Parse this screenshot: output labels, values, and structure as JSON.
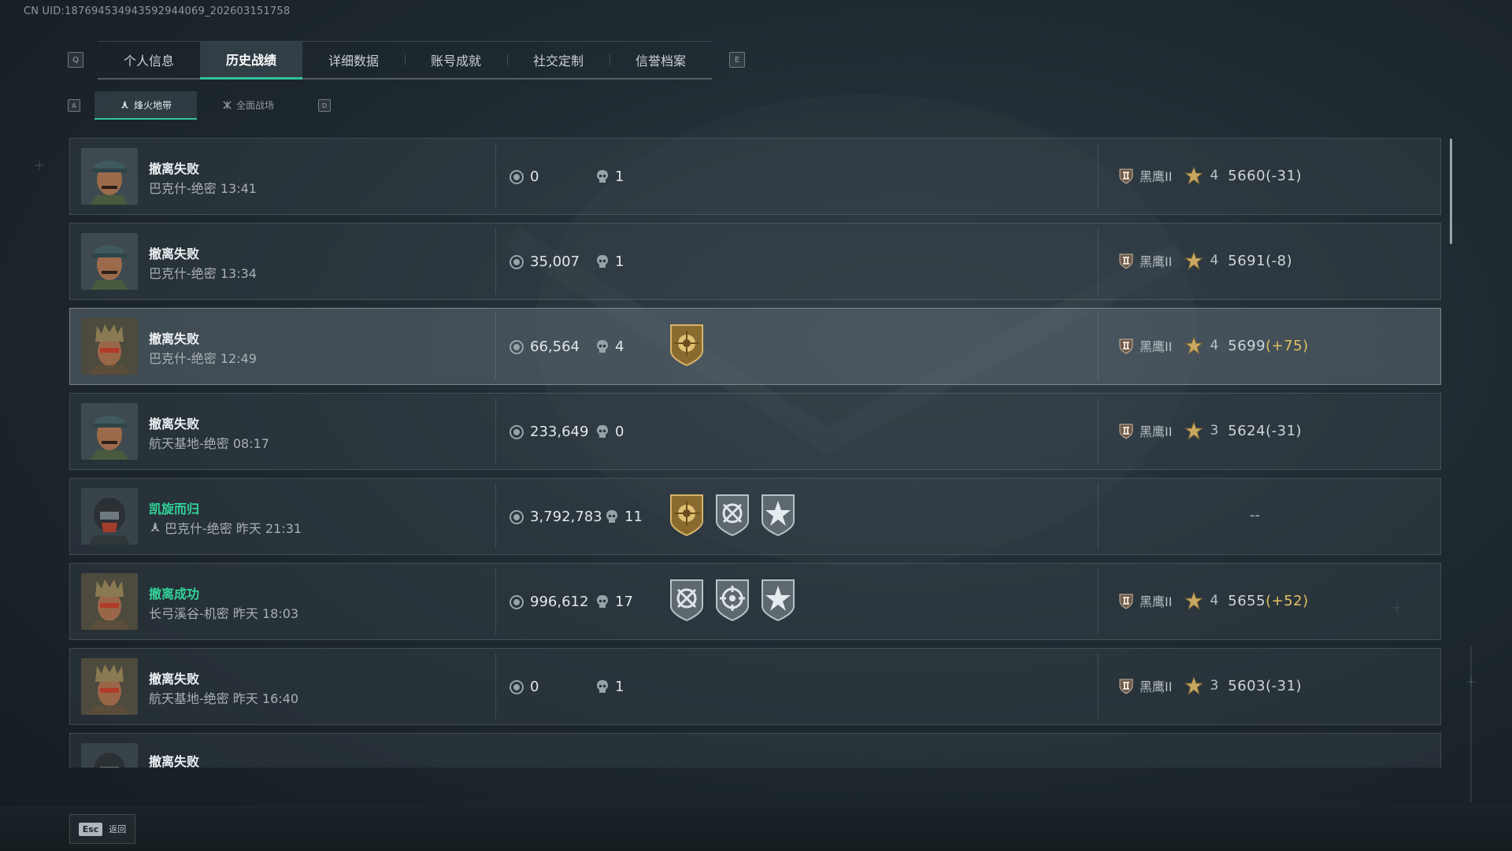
{
  "header": {
    "uid": "CN UID:18769453494359294406​9_202603151758"
  },
  "tabs": {
    "left_key": "Q",
    "right_key": "E",
    "items": [
      {
        "label": "个人信息",
        "active": false
      },
      {
        "label": "历史战绩",
        "active": true
      },
      {
        "label": "详细数据",
        "active": false
      },
      {
        "label": "账号成就",
        "active": false
      },
      {
        "label": "社交定制",
        "active": false
      },
      {
        "label": "信誉档案",
        "active": false
      }
    ]
  },
  "subtabs": {
    "left_key": "A",
    "right_key": "D",
    "items": [
      {
        "label": "烽火地带",
        "icon": "hazard-icon",
        "active": true
      },
      {
        "label": "全面战场",
        "icon": "battlefield-icon",
        "active": false
      }
    ]
  },
  "records": [
    {
      "title": "撤离失败",
      "subtitle": "巴克什-绝密 13:41",
      "coins": "0",
      "kills": "1",
      "rank": "黑鹰II",
      "stars": "4",
      "score": "5660",
      "delta": "(-31)",
      "success": false
    },
    {
      "title": "撤离失败",
      "subtitle": "巴克什-绝密 13:34",
      "coins": "35,007",
      "kills": "1",
      "rank": "黑鹰II",
      "stars": "4",
      "score": "5691",
      "delta": "(-8)",
      "success": false
    },
    {
      "title": "撤离失败",
      "subtitle": "巴克什-绝密 12:49",
      "coins": "66,564",
      "kills": "4",
      "rank": "黑鹰II",
      "stars": "4",
      "score": "5699",
      "delta": "(+75)",
      "success": false
    },
    {
      "title": "撤离失败",
      "subtitle": "航天基地-绝密 08:17",
      "coins": "233,649",
      "kills": "0",
      "rank": "黑鹰II",
      "stars": "3",
      "score": "5624",
      "delta": "(-31)",
      "success": false
    },
    {
      "title": "凯旋而归",
      "subtitle": "巴克什-绝密 昨天 21:31",
      "coins": "3,792,783",
      "kills": "11",
      "rank_empty": "--",
      "success": true
    },
    {
      "title": "撤离成功",
      "subtitle": "长弓溪谷-机密 昨天 18:03",
      "coins": "996,612",
      "kills": "17",
      "rank": "黑鹰II",
      "stars": "4",
      "score": "5655",
      "delta": "(+52)",
      "success": true
    },
    {
      "title": "撤离失败",
      "subtitle": "航天基地-绝密 昨天 16:40",
      "coins": "0",
      "kills": "1",
      "rank": "黑鹰II",
      "stars": "3",
      "score": "5603",
      "delta": "(-31)",
      "success": false
    },
    {
      "title": "撤离失败",
      "success": false
    }
  ],
  "footer": {
    "esc_key": "Esc",
    "back_label": "返回"
  },
  "colors": {
    "accent": "#33c39a",
    "success_text": "#33d39a",
    "positive_delta": "#e5c063"
  }
}
